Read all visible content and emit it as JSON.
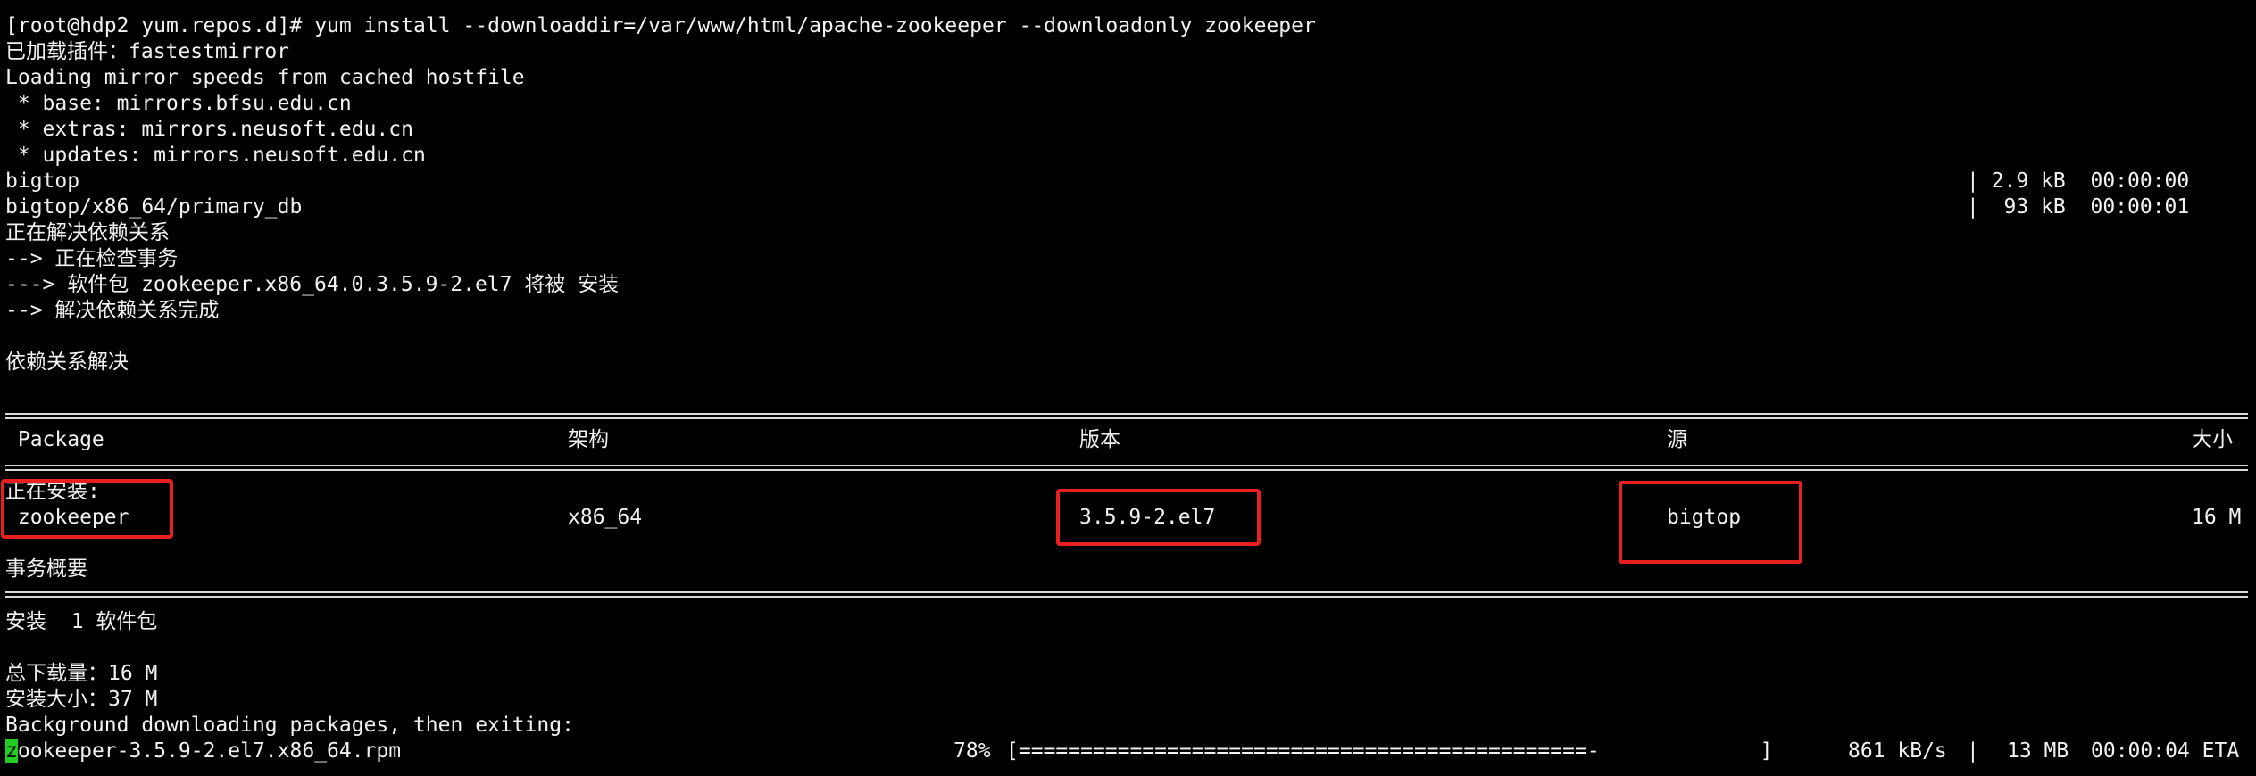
{
  "terminal": {
    "prompt": "[root@hdp2 yum.repos.d]#",
    "command": "yum install --downloaddir=/var/www/html/apache-zookeeper --downloadonly zookeeper",
    "plugins_line": "已加载插件：fastestmirror",
    "mirror_line": "Loading mirror speeds from cached hostfile",
    "mirrors": [
      " * base: mirrors.bfsu.edu.cn",
      " * extras: mirrors.neusoft.edu.cn",
      " * updates: mirrors.neusoft.edu.cn"
    ],
    "repo_downloads": [
      {
        "name": "bigtop",
        "stats": "| 2.9 kB  00:00:00"
      },
      {
        "name": "bigtop/x86_64/primary_db",
        "stats": "|  93 kB  00:00:01"
      }
    ],
    "resolve_lines": [
      "正在解决依赖关系",
      "--> 正在检查事务",
      "---> 软件包 zookeeper.x86_64.0.3.5.9-2.el7 将被 安装",
      "--> 解决依赖关系完成"
    ],
    "resolved_line": "依赖关系解决",
    "table": {
      "headers": {
        "package": " Package",
        "arch": "架构",
        "version": "版本",
        "repo": "源",
        "size": "大小"
      },
      "section_label": "正在安装:",
      "row": {
        "package": " zookeeper",
        "arch": "x86_64",
        "version": "3.5.9-2.el7",
        "repo": "bigtop",
        "size": "16 M"
      }
    },
    "summary_title": "事务概要",
    "install_summary": "安装  1 软件包",
    "total_download": "总下载量：16 M",
    "install_size": "安装大小：37 M",
    "background_line": "Background downloading packages, then exiting:",
    "progress": {
      "cursor_char": "z",
      "file_rest": "ookeeper-3.5.9-2.el7.x86_64.rpm",
      "percent_label": "78%",
      "percent": 78,
      "bar": "[==============================================-             ]",
      "rate": "861 kB/s",
      "size": "13 MB",
      "eta": "00:00:04 ETA"
    },
    "colors": {
      "background": "#000000",
      "text": "#f2f2f2",
      "highlight": "#e82020",
      "cursor": "#22cc22"
    }
  }
}
